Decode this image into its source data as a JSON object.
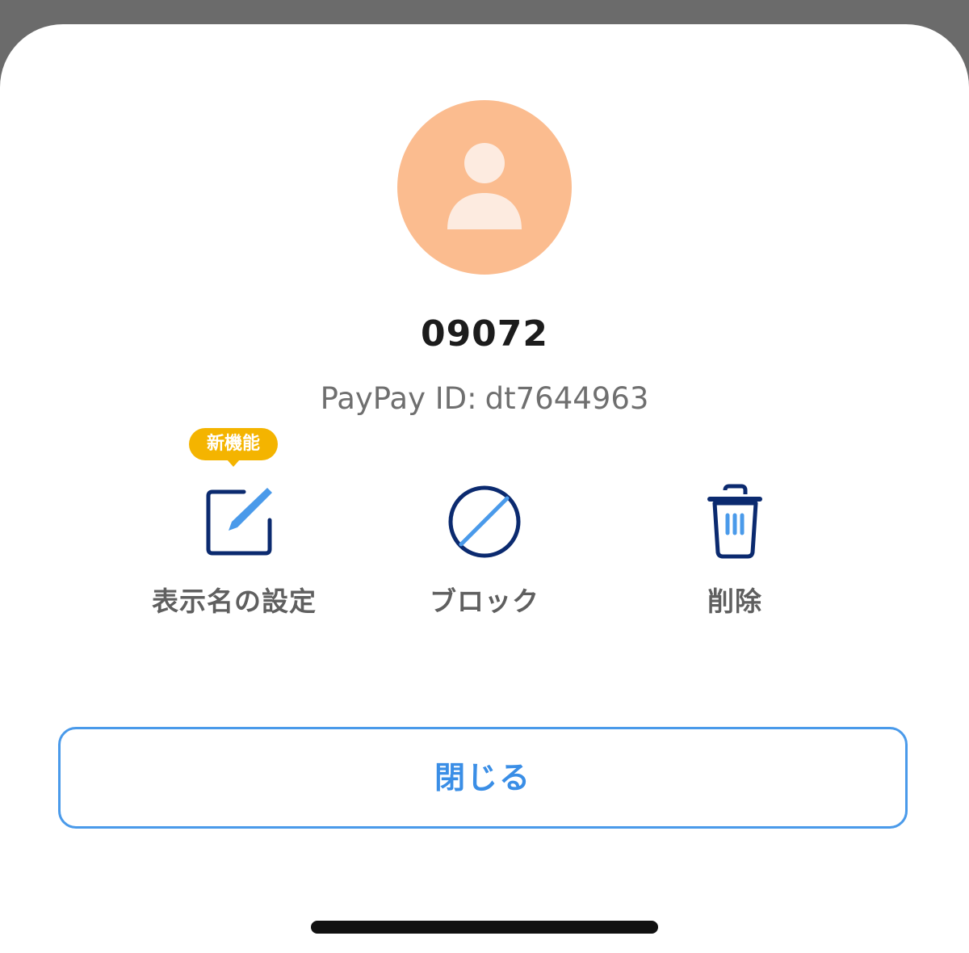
{
  "profile": {
    "display_name": "09072",
    "id_label": "PayPay ID:",
    "id_value": "dt7644963",
    "avatar_icon": "user-silhouette-icon"
  },
  "actions": [
    {
      "label": "表示名の設定",
      "icon": "edit-icon",
      "badge": "新機能"
    },
    {
      "label": "ブロック",
      "icon": "block-icon"
    },
    {
      "label": "削除",
      "icon": "trash-icon"
    }
  ],
  "close_button": {
    "label": "閉じる"
  },
  "colors": {
    "avatar_bg": "#fbbc8f",
    "avatar_fg": "#fdebe0",
    "icon_dark": "#0b2a6f",
    "icon_accent": "#4a9aea",
    "badge": "#f4b400",
    "close_text": "#3a8ee6"
  }
}
